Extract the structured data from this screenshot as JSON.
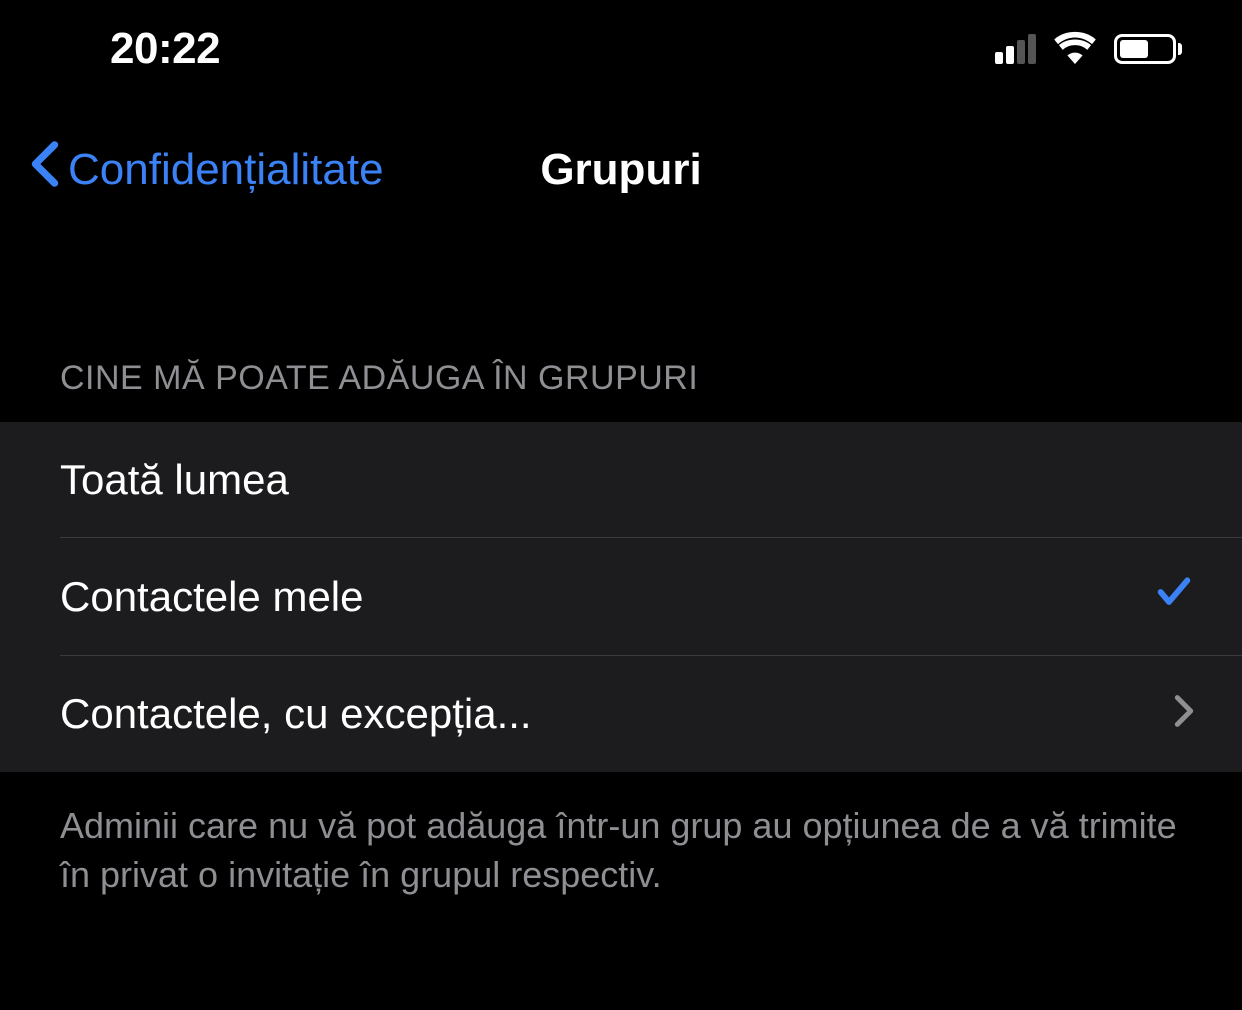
{
  "status_bar": {
    "time": "20:22"
  },
  "nav": {
    "back_label": "Confidențialitate",
    "title": "Grupuri"
  },
  "section": {
    "header": "CINE MĂ POATE ADĂUGA ÎN GRUPURI",
    "options": {
      "everyone": "Toată lumea",
      "my_contacts": "Contactele mele",
      "contacts_except": "Contactele, cu excepția..."
    },
    "selected": "my_contacts",
    "footer": "Adminii care nu vă pot adăuga într-un grup au opțiunea de a vă trimite în privat o invitație în grupul respectiv."
  }
}
